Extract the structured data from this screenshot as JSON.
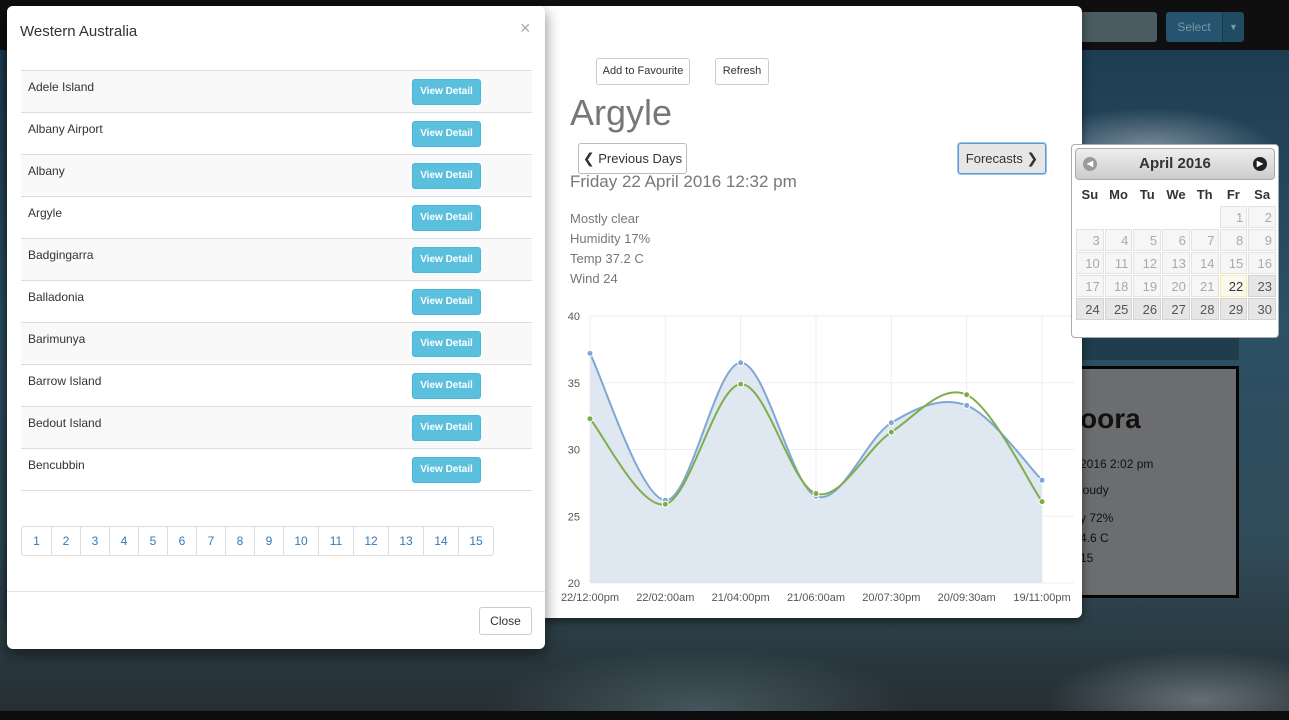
{
  "header": {
    "select_label": "Select",
    "select_caret": "▼"
  },
  "background_card": {
    "title_fragment": "oora",
    "date_fragment": "2016 2:02 pm",
    "lines": [
      "loudy",
      "y 72%",
      "4.6 C",
      "15"
    ]
  },
  "list_modal": {
    "title": "Western Australia",
    "close_symbol": "×",
    "view_button_label": "View Detail",
    "stations": [
      "Adele Island",
      "Albany Airport",
      "Albany",
      "Argyle",
      "Badgingarra",
      "Balladonia",
      "Barimunya",
      "Barrow Island",
      "Bedout Island",
      "Bencubbin"
    ],
    "pages": [
      "1",
      "2",
      "3",
      "4",
      "5",
      "6",
      "7",
      "8",
      "9",
      "10",
      "11",
      "12",
      "13",
      "14",
      "15"
    ],
    "close_button_label": "Close"
  },
  "detail": {
    "add_favourite_label": "Add to Favourite",
    "refresh_label": "Refresh",
    "station_name": "Argyle",
    "previous_days_label": "Previous Days",
    "previous_days_icon": "chevron-left-icon",
    "forecasts_label": "Forecasts",
    "forecasts_icon": "chevron-right-icon",
    "observation_date": "Friday 22 April 2016 12:32 pm",
    "observations": [
      "Mostly clear",
      "Humidity 17%",
      "Temp 37.2 C",
      "Wind 24"
    ]
  },
  "datepicker": {
    "month_label": "April 2016",
    "prev_icon": "prev-month-icon",
    "next_icon": "next-month-icon",
    "weekdays": [
      "Su",
      "Mo",
      "Tu",
      "We",
      "Th",
      "Fr",
      "Sa"
    ],
    "weeks": [
      [
        "",
        "",
        "",
        "",
        "",
        "1",
        "2"
      ],
      [
        "3",
        "4",
        "5",
        "6",
        "7",
        "8",
        "9"
      ],
      [
        "10",
        "11",
        "12",
        "13",
        "14",
        "15",
        "16"
      ],
      [
        "17",
        "18",
        "19",
        "20",
        "21",
        "22",
        "23"
      ],
      [
        "24",
        "25",
        "26",
        "27",
        "28",
        "29",
        "30"
      ]
    ],
    "today": "22"
  },
  "colors": {
    "blue_series": "#7fa7d6",
    "green_series": "#7fad4c",
    "fill": "#dbe6ef",
    "view_button": "#5bc0de"
  },
  "chart_data": {
    "type": "line",
    "x": [
      "22/12:00pm",
      "22/02:00am",
      "21/04:00pm",
      "21/06:00am",
      "20/07:30pm",
      "20/09:30am",
      "19/11:00pm"
    ],
    "ylim": [
      20,
      40
    ],
    "yticks": [
      20,
      25,
      30,
      35,
      40
    ],
    "series": [
      {
        "values": [
          37.2,
          26.2,
          36.5,
          26.5,
          32.0,
          33.3,
          27.7
        ]
      },
      {
        "values": [
          32.3,
          25.9,
          34.9,
          26.7,
          31.3,
          34.1,
          26.1
        ]
      }
    ],
    "grid": true
  }
}
